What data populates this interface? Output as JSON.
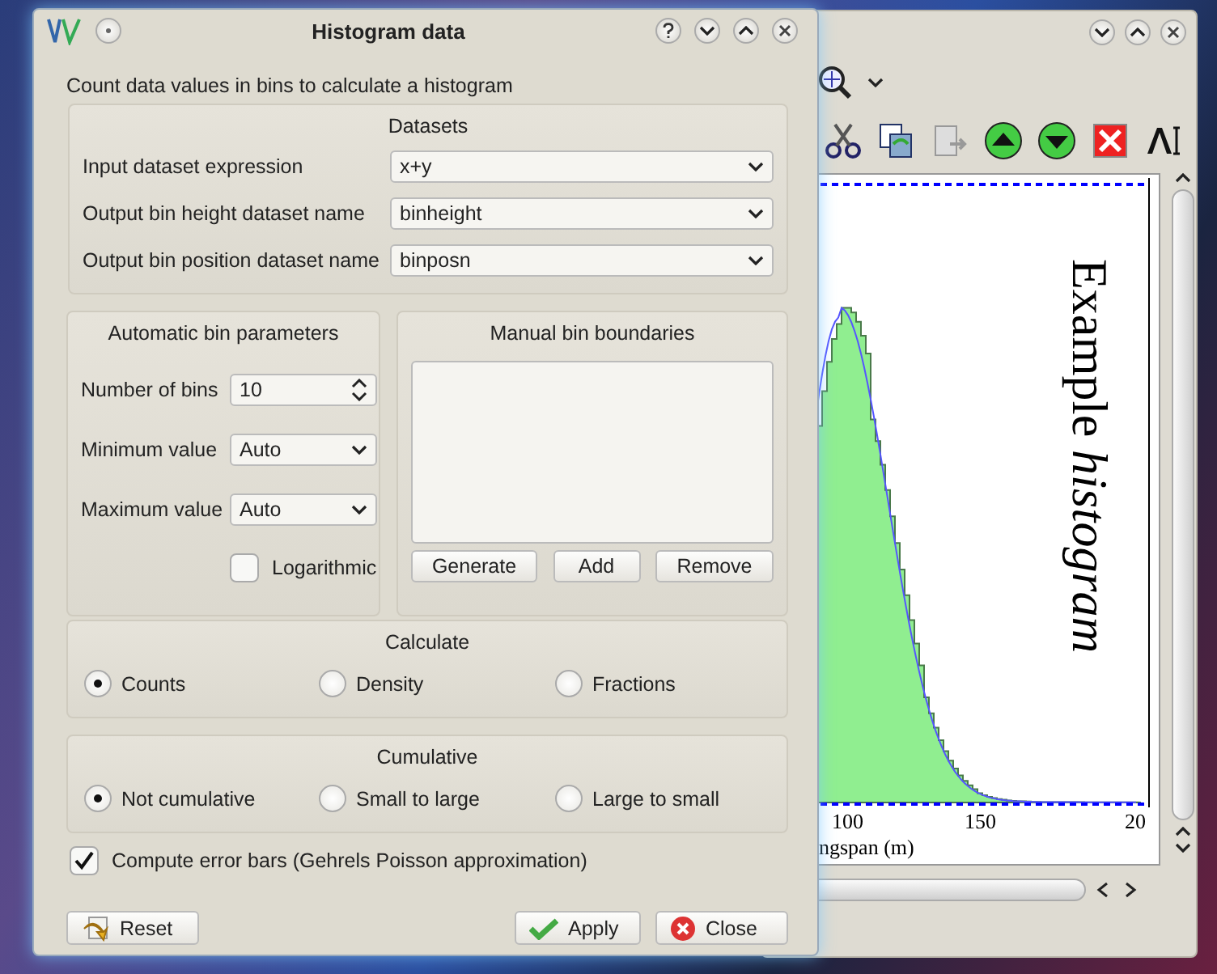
{
  "window": {
    "title": "Histogram data"
  },
  "description": "Count data values in bins to calculate a histogram",
  "datasets": {
    "title": "Datasets",
    "fields": [
      {
        "label": "Input dataset expression",
        "value": "x+y"
      },
      {
        "label": "Output bin height dataset name",
        "value": "binheight"
      },
      {
        "label": "Output bin position dataset name",
        "value": "binposn"
      }
    ]
  },
  "automatic": {
    "title": "Automatic bin parameters",
    "fields": [
      {
        "label": "Number of bins",
        "value": "10",
        "kind": "spin"
      },
      {
        "label": "Minimum value",
        "value": "Auto",
        "kind": "combo"
      },
      {
        "label": "Maximum value",
        "value": "Auto",
        "kind": "combo"
      }
    ],
    "logarithmic": {
      "label": "Logarithmic",
      "checked": false
    }
  },
  "manual": {
    "title": "Manual bin boundaries",
    "buttons": [
      "Generate",
      "Add",
      "Remove"
    ]
  },
  "calculate": {
    "title": "Calculate",
    "options": [
      {
        "label": "Counts",
        "selected": true
      },
      {
        "label": "Density",
        "selected": false
      },
      {
        "label": "Fractions",
        "selected": false
      }
    ]
  },
  "cumulative": {
    "title": "Cumulative",
    "options": [
      {
        "label": "Not cumulative",
        "selected": true
      },
      {
        "label": "Small to large",
        "selected": false
      },
      {
        "label": "Large to small",
        "selected": false
      }
    ]
  },
  "error_bars": {
    "label": "Compute error bars (Gehrels Poisson approximation)",
    "checked": true
  },
  "buttons": [
    {
      "label": "Reset",
      "kind": "reset"
    },
    {
      "label": "Apply",
      "kind": "apply"
    },
    {
      "label": "Close",
      "kind": "close"
    }
  ],
  "plot": {
    "title": "Example *histogram*",
    "xticks": [
      "100",
      "150",
      "20"
    ],
    "xlabel": "ngspan (m)"
  }
}
